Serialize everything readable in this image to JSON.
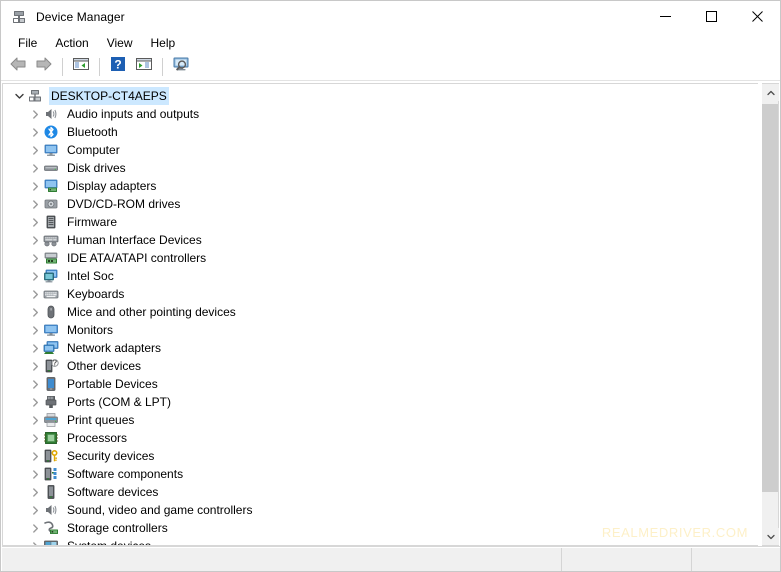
{
  "window": {
    "title": "Device Manager",
    "icon": "device-manager-icon",
    "controls": {
      "minimize": "minimize-button",
      "maximize": "maximize-button",
      "close": "close-button"
    }
  },
  "menu": {
    "items": [
      {
        "label": "File",
        "name": "menu-file"
      },
      {
        "label": "Action",
        "name": "menu-action"
      },
      {
        "label": "View",
        "name": "menu-view"
      },
      {
        "label": "Help",
        "name": "menu-help"
      }
    ]
  },
  "toolbar": {
    "buttons": [
      {
        "icon": "back-arrow-icon",
        "name": "toolbar-back"
      },
      {
        "icon": "forward-arrow-icon",
        "name": "toolbar-forward"
      },
      {
        "icon": "show-hide-console-tree-icon",
        "name": "toolbar-console-tree"
      },
      {
        "icon": "help-question-icon",
        "name": "toolbar-help"
      },
      {
        "icon": "properties-icon",
        "name": "toolbar-properties"
      },
      {
        "icon": "scan-for-hardware-changes-icon",
        "name": "toolbar-scan-hardware"
      }
    ]
  },
  "tree": {
    "root": {
      "label": "DESKTOP-CT4AEPS",
      "icon": "computer-root-icon",
      "expanded": true,
      "selected": true
    },
    "nodes": [
      {
        "label": "Audio inputs and outputs",
        "icon": "speaker-icon"
      },
      {
        "label": "Bluetooth",
        "icon": "bluetooth-icon"
      },
      {
        "label": "Computer",
        "icon": "monitor-icon"
      },
      {
        "label": "Disk drives",
        "icon": "disk-drive-icon"
      },
      {
        "label": "Display adapters",
        "icon": "display-adapter-icon"
      },
      {
        "label": "DVD/CD-ROM drives",
        "icon": "optical-drive-icon"
      },
      {
        "label": "Firmware",
        "icon": "firmware-chip-icon"
      },
      {
        "label": "Human Interface Devices",
        "icon": "hid-keyboard-icon"
      },
      {
        "label": "IDE ATA/ATAPI controllers",
        "icon": "ide-controller-icon"
      },
      {
        "label": "Intel Soc",
        "icon": "soc-monitor-icon"
      },
      {
        "label": "Keyboards",
        "icon": "keyboard-icon"
      },
      {
        "label": "Mice and other pointing devices",
        "icon": "mouse-icon"
      },
      {
        "label": "Monitors",
        "icon": "monitor-screen-icon"
      },
      {
        "label": "Network adapters",
        "icon": "network-adapter-icon"
      },
      {
        "label": "Other devices",
        "icon": "unknown-device-icon"
      },
      {
        "label": "Portable Devices",
        "icon": "portable-device-icon"
      },
      {
        "label": "Ports (COM & LPT)",
        "icon": "port-connector-icon"
      },
      {
        "label": "Print queues",
        "icon": "printer-icon"
      },
      {
        "label": "Processors",
        "icon": "processor-chip-icon"
      },
      {
        "label": "Security devices",
        "icon": "security-key-icon"
      },
      {
        "label": "Software components",
        "icon": "software-component-icon"
      },
      {
        "label": "Software devices",
        "icon": "software-device-icon"
      },
      {
        "label": "Sound, video and game controllers",
        "icon": "sound-controller-icon"
      },
      {
        "label": "Storage controllers",
        "icon": "storage-controller-icon"
      },
      {
        "label": "System devices",
        "icon": "system-device-icon"
      }
    ]
  },
  "scrollbar": {
    "up_arrow": "scroll-up-arrow",
    "down_arrow": "scroll-down-arrow"
  },
  "statusbar": {
    "pane1": "",
    "pane2": "",
    "pane3": ""
  },
  "watermark": {
    "text": "REALMEDRIVER.COM",
    "color": "#fdf0c8"
  },
  "colors": {
    "selection": "#cce8ff",
    "window_bg": "#ffffff",
    "toolbar_bg": "#ffffff",
    "status_bg": "#f0f0f0",
    "scroll_thumb": "#cdcdcd"
  }
}
